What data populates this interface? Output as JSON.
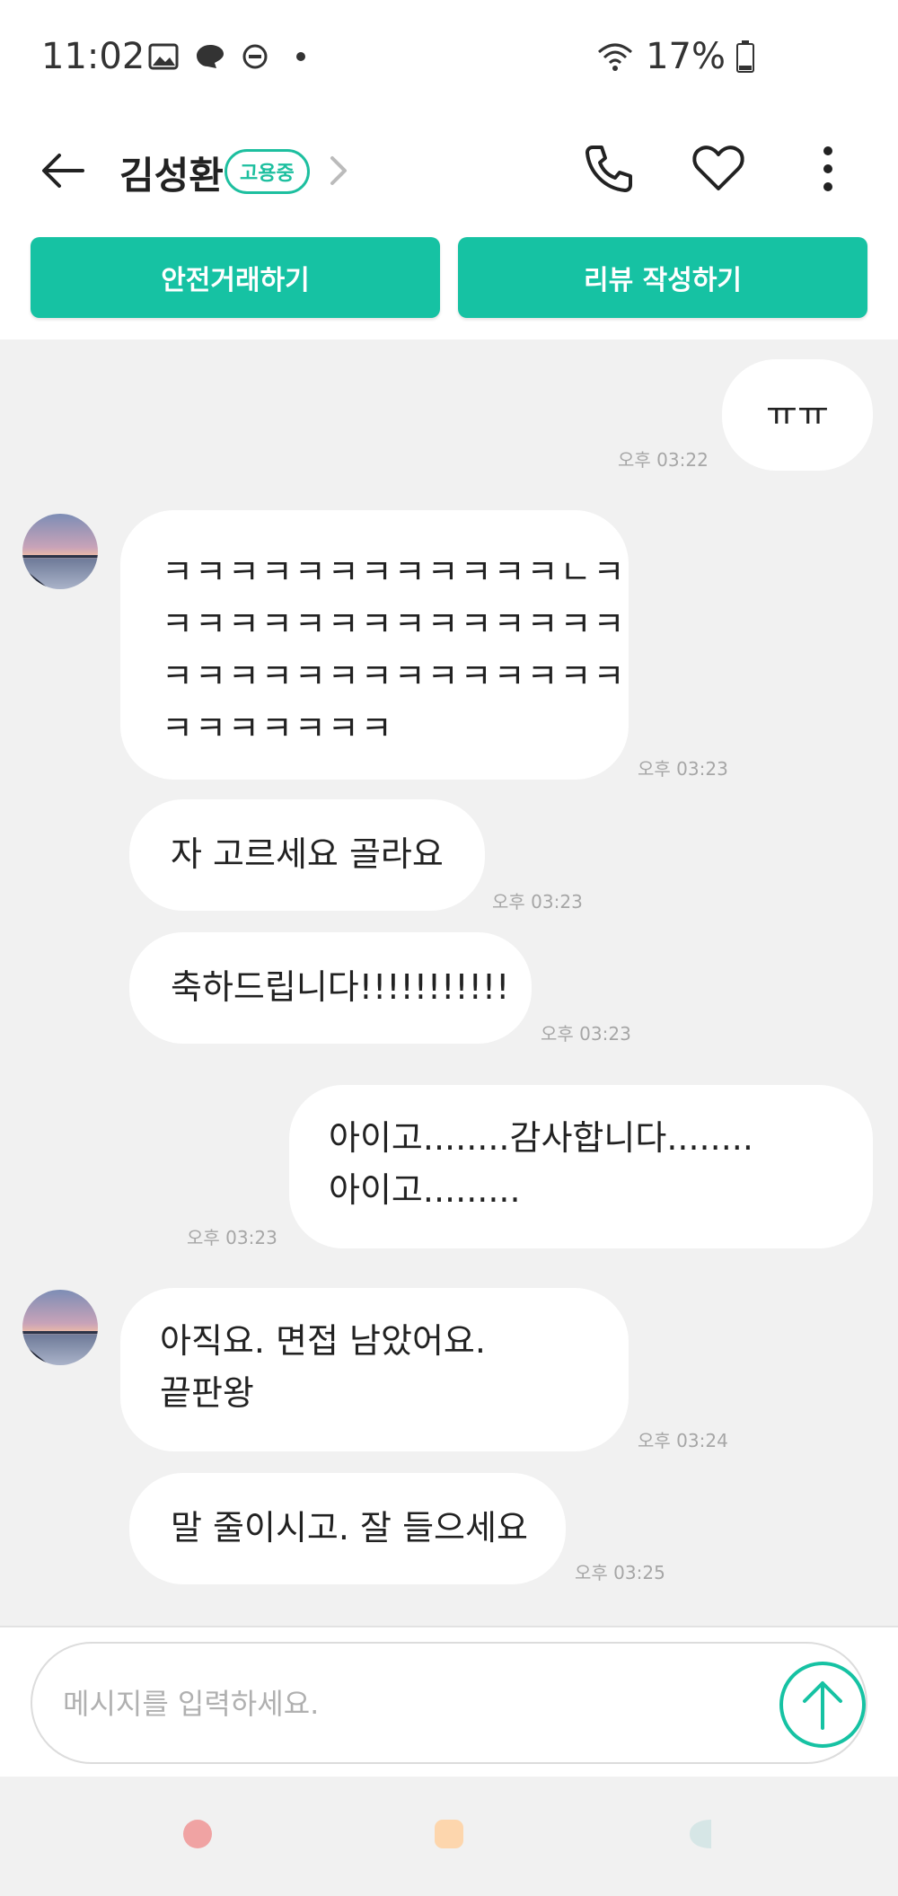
{
  "status_bar": {
    "time": "11:02",
    "battery": "17%"
  },
  "header": {
    "contact_name": "김성환",
    "badge": "고용중"
  },
  "actions": {
    "safe_trade": "안전거래하기",
    "write_review": "리뷰 작성하기"
  },
  "messages": [
    {
      "side": "right",
      "text": "ㅠㅠ",
      "time": "오후 03:22"
    },
    {
      "side": "left",
      "text": "ㅋㅋㅋㅋㅋㅋㅋㅋㅋㅋㅋㅋㄴㅋ\nㅋㅋㅋㅋㅋㅋㅋㅋㅋㅋㅋㅋㅋㅋ\nㅋㅋㅋㅋㅋㅋㅋㅋㅋㅋㅋㅋㅋㅋ\nㅋㅋㅋㅋㅋㅋㅋ",
      "time": "오후 03:23"
    },
    {
      "side": "left",
      "text": "자 고르세요 골라요",
      "time": "오후 03:23"
    },
    {
      "side": "left",
      "text": "축하드립니다!!!!!!!!!!!",
      "time": "오후 03:23"
    },
    {
      "side": "right",
      "text": "아이고........감사합니다........\n아이고.........",
      "time": "오후 03:23"
    },
    {
      "side": "left",
      "text": "아직요. 면접 남았어요.\n끝판왕",
      "time": "오후 03:24"
    },
    {
      "side": "left",
      "text": "말 줄이시고. 잘 들으세요",
      "time": "오후 03:25"
    }
  ],
  "input": {
    "placeholder": "메시지를 입력하세요."
  },
  "colors": {
    "accent": "#16c2a3",
    "chat_bg": "#f1f1f1"
  },
  "icons": [
    "back-arrow-icon",
    "chevron-right-icon",
    "phone-icon",
    "heart-icon",
    "more-vertical-icon",
    "send-arrow-icon"
  ]
}
